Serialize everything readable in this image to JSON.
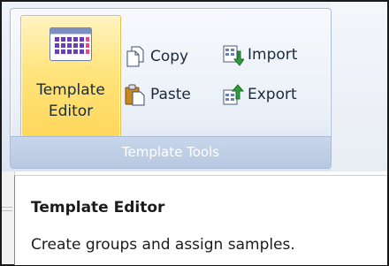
{
  "ribbon": {
    "group_label": "Template Tools",
    "template_editor": {
      "label_line1": "Template",
      "label_line2": "Editor",
      "icon": "template-grid-icon"
    },
    "copy": {
      "label": "Copy",
      "icon": "copy-icon"
    },
    "paste": {
      "label": "Paste",
      "icon": "paste-icon"
    },
    "import": {
      "label": "Import",
      "icon": "import-icon"
    },
    "export": {
      "label": "Export",
      "icon": "export-icon"
    }
  },
  "tooltip": {
    "title": "Template Editor",
    "description": "Create groups and assign samples."
  },
  "colors": {
    "hover_gold": "#ffd75a",
    "group_label_bg": "#b7c8e1",
    "grid_purple": "#6a3fb3"
  }
}
